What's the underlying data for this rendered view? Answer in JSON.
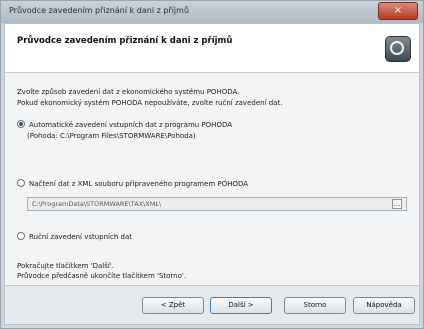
{
  "window": {
    "title": "Průvodce zavedením přiznání k dani z příjmů",
    "close_glyph": "×"
  },
  "header": {
    "title": "Průvodce zavedením přiznání k dani z příjmů",
    "logo_icon": "pohoda-logo-icon"
  },
  "intro": {
    "line1": "Zvolte způsob zavedení dat z ekonomického systému POHODA.",
    "line2": "Pokud ekonomický systém POHODA nepoužíváte, zvolte ruční zavedení dat."
  },
  "options": {
    "auto": {
      "label": "Automatické zavedení vstupních dat z programu POHODA",
      "detail": "(Pohoda: C:\\Program Files\\STORMWARE\\Pohoda)",
      "selected": true
    },
    "xml": {
      "label": "Načtení dat z XML souboru připraveného programem POHODA",
      "path": "C:\\ProgramData\\STORMWARE\\TAX\\XML\\",
      "browse_glyph": "…",
      "selected": false
    },
    "manual": {
      "label": "Ruční zavedení vstupních dat",
      "selected": false
    }
  },
  "footer_text": {
    "line1": "Pokračujte tlačítkem 'Další'.",
    "line2": "Průvodce předčasně ukončíte tlačítkem 'Storno'."
  },
  "buttons": {
    "back": "< Zpět",
    "next": "Další >",
    "cancel": "Storno",
    "help": "Nápověda"
  }
}
